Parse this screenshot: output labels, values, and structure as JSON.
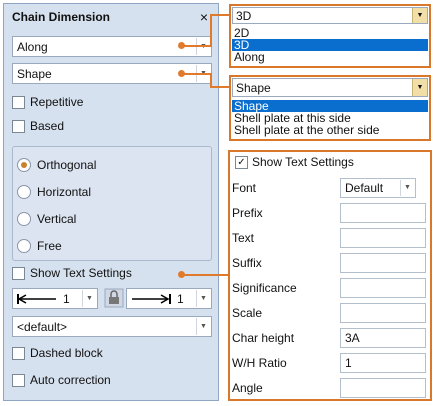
{
  "panel": {
    "title": "Chain Dimension",
    "close_glyph": "×",
    "direction_value": "Along",
    "reference_value": "Shape",
    "repetitive_label": "Repetitive",
    "based_label": "Based",
    "radios": [
      "Orthogonal",
      "Horizontal",
      "Vertical",
      "Free"
    ],
    "radio_selected": "Orthogonal",
    "show_text_label": "Show Text Settings",
    "left_arrow_value": "1",
    "right_arrow_value": "1",
    "style_value": "<default>",
    "dashed_label": "Dashed block",
    "auto_label": "Auto correction"
  },
  "callout_direction": {
    "current": "3D",
    "options": [
      "2D",
      "3D",
      "Along"
    ],
    "selected": "3D"
  },
  "callout_reference": {
    "current": "Shape",
    "options": [
      "Shape",
      "Shell plate at this side",
      "Shell plate at the other side"
    ],
    "selected": "Shape"
  },
  "callout_text": {
    "header": "Show Text Settings",
    "rows": [
      {
        "label": "Font",
        "value": "Default"
      },
      {
        "label": "Prefix",
        "value": ""
      },
      {
        "label": "Text",
        "value": ""
      },
      {
        "label": "Suffix",
        "value": ""
      },
      {
        "label": "Significance",
        "value": ""
      },
      {
        "label": "Scale",
        "value": ""
      },
      {
        "label": "Char height",
        "value": "3A"
      },
      {
        "label": "W/H Ratio",
        "value": "1"
      },
      {
        "label": "Angle",
        "value": ""
      }
    ]
  },
  "colors": {
    "accent": "#e07b2e",
    "selection": "#0a6ecf",
    "panel_bg": "#d6e1ef"
  }
}
